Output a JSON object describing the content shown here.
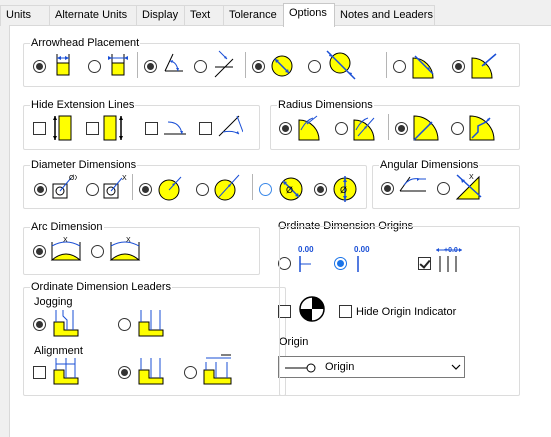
{
  "tabs": [
    {
      "label": "Units"
    },
    {
      "label": "Alternate Units"
    },
    {
      "label": "Display"
    },
    {
      "label": "Text"
    },
    {
      "label": "Tolerance"
    },
    {
      "label": "Options"
    },
    {
      "label": "Notes and Leaders"
    }
  ],
  "active_tab": "Options",
  "groups": {
    "arrowhead": {
      "title": "Arrowhead Placement"
    },
    "hide_ext": {
      "title": "Hide Extension Lines"
    },
    "radius": {
      "title": "Radius Dimensions"
    },
    "diameter": {
      "title": "Diameter Dimensions"
    },
    "angular": {
      "title": "Angular Dimensions"
    },
    "arc": {
      "title": "Arc Dimension"
    },
    "ord_leaders": {
      "title": "Ordinate Dimension Leaders",
      "jogging": "Jogging",
      "alignment": "Alignment"
    },
    "ord_origins": {
      "title": "Ordinate Dimension Origins",
      "value_label": "0.00",
      "hide_origin": "Hide Origin Indicator",
      "origin_label": "Origin",
      "origin_select": "Origin"
    }
  },
  "colors": {
    "accent_yellow": "#ffff00",
    "arrow_blue": "#1a4fd6",
    "radio_blue": "#1a73e8"
  },
  "icons": {
    "dropdown": "chevron-down-icon"
  }
}
